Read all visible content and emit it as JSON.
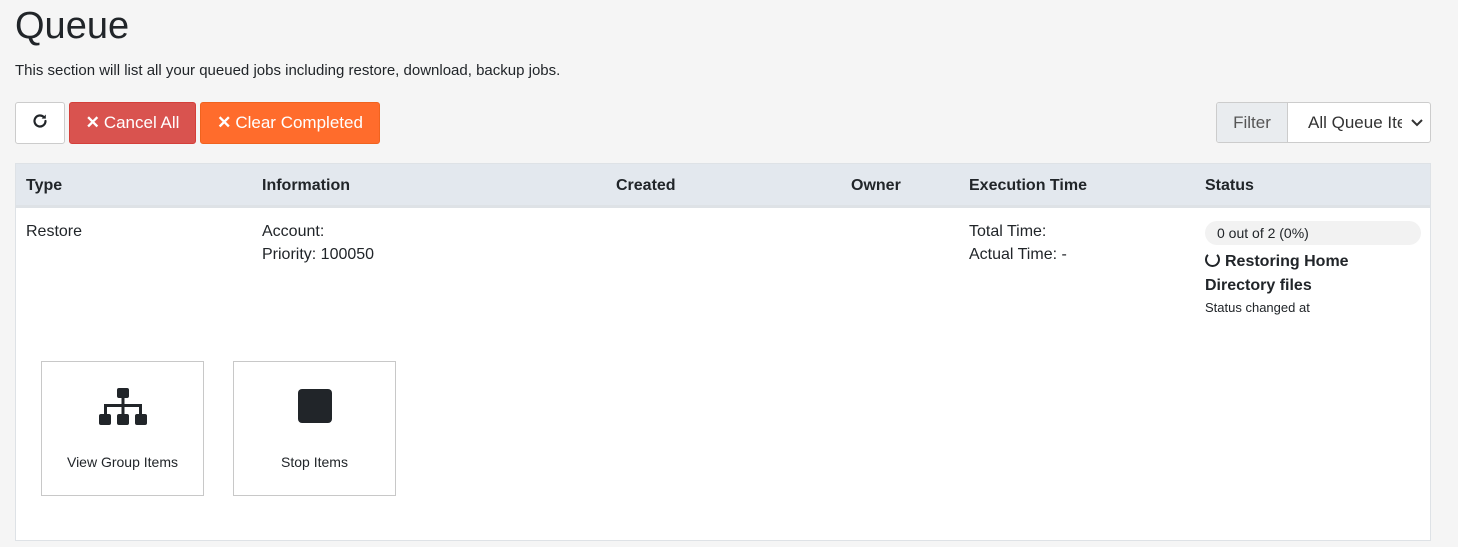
{
  "page": {
    "title": "Queue",
    "description": "This section will list all your queued jobs including restore, download, backup jobs."
  },
  "toolbar": {
    "refresh_icon": "refresh-icon",
    "cancel_all_label": "Cancel All",
    "clear_completed_label": "Clear Completed",
    "filter_label": "Filter",
    "filter_value": "All Queue Items"
  },
  "colors": {
    "cancel": "#d9534f",
    "clear": "#ff6c2c",
    "header_bg": "#e3e8ee"
  },
  "table": {
    "headers": [
      "Type",
      "Information",
      "Created",
      "Owner",
      "Execution Time",
      "Status"
    ],
    "rows": [
      {
        "type": "Restore",
        "info_account": "Account:",
        "info_priority": "Priority: 100050",
        "created": "",
        "owner": "",
        "exec_total": "Total Time:",
        "exec_actual": "Actual Time: -",
        "progress_text": "0 out of 2 (0%)",
        "progress": 0,
        "status_main": "Restoring Home Directory files",
        "status_sub": "Status changed at"
      }
    ]
  },
  "actions": {
    "view_group_label": "View Group Items",
    "stop_label": "Stop Items"
  }
}
